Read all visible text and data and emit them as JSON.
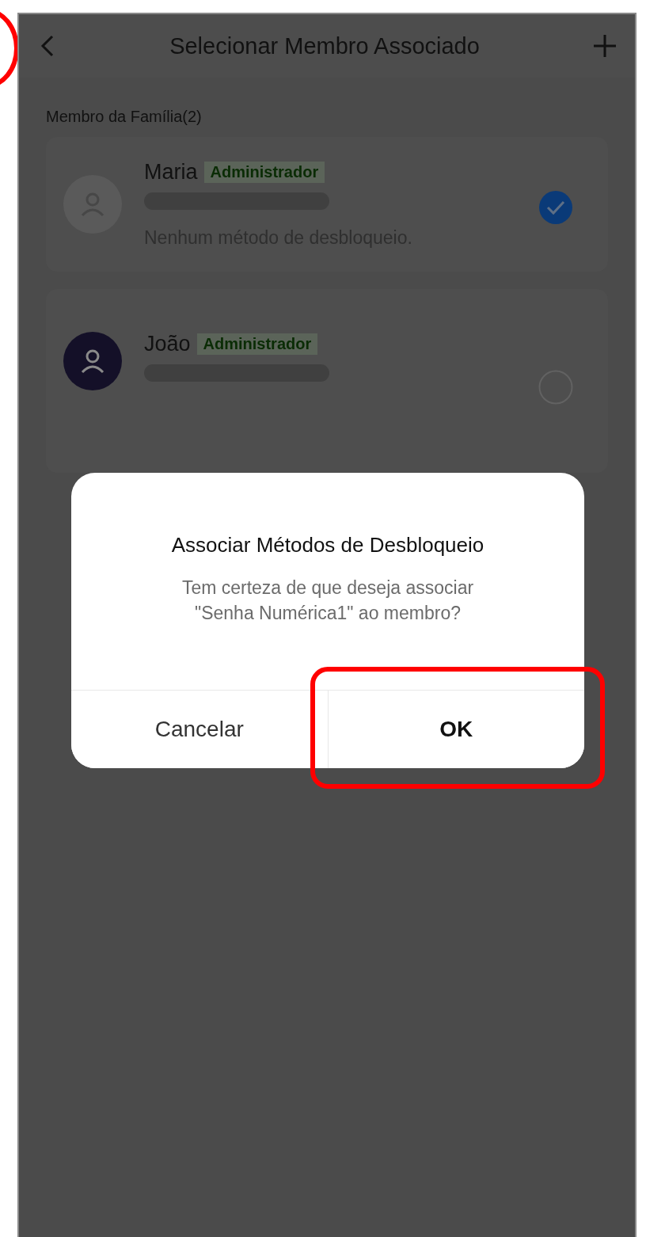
{
  "header": {
    "title": "Selecionar Membro Associado"
  },
  "section_label": "Membro da Família(2)",
  "members": [
    {
      "name": "Maria",
      "role": "Administrador",
      "detail": "Nenhum método de desbloqueio.",
      "selected": true,
      "color": "#5a5a5a"
    },
    {
      "name": "João",
      "role": "Administrador",
      "selected": false,
      "color": "#141028"
    }
  ],
  "dialog": {
    "title": "Associar Métodos de Desbloqueio",
    "message": "Tem certeza de que deseja associar \"Senha Numérica1\" ao membro?",
    "buttons": [
      {
        "label": "Cancelar",
        "kind": "cancel"
      },
      {
        "label": "OK",
        "kind": "confirm"
      }
    ]
  }
}
